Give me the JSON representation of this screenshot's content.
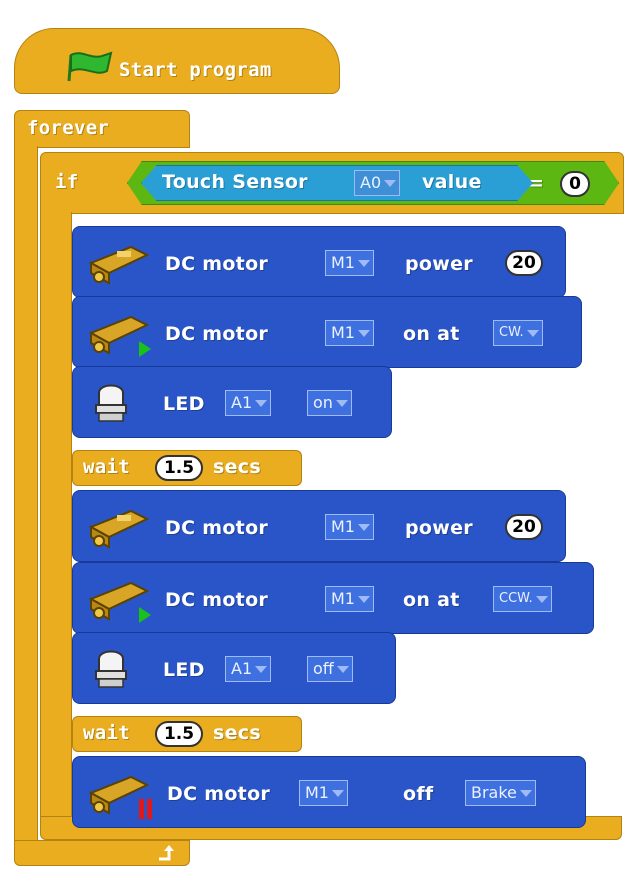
{
  "script": {
    "hat_label": "Start program",
    "forever_label": "forever",
    "if_label": "if",
    "condition": {
      "sensor_label": "Touch Sensor",
      "port": "A0",
      "value_label": "value",
      "equals": "=",
      "compare_value": "0"
    },
    "blocks": [
      {
        "motor_label": "DC motor",
        "port": "M1",
        "action": "power",
        "value": "20"
      },
      {
        "motor_label": "DC motor",
        "port": "M1",
        "action": "on at",
        "direction": "CW."
      },
      {
        "led_label": "LED",
        "port": "A1",
        "state": "on"
      },
      {
        "wait_label": "wait",
        "seconds": "1.5",
        "unit": "secs"
      },
      {
        "motor_label": "DC motor",
        "port": "M1",
        "action": "power",
        "value": "20"
      },
      {
        "motor_label": "DC motor",
        "port": "M1",
        "action": "on at",
        "direction": "CCW."
      },
      {
        "led_label": "LED",
        "port": "A1",
        "state": "off"
      },
      {
        "wait_label": "wait",
        "seconds": "1.5",
        "unit": "secs"
      },
      {
        "motor_label": "DC motor",
        "port": "M1",
        "action": "off",
        "mode": "Brake"
      }
    ]
  },
  "colors": {
    "control": "#e9ad1f",
    "motion": "#2a55c8",
    "sensor": "#2a9fd6",
    "operator": "#5cb712",
    "flag": "#2fb82f"
  }
}
